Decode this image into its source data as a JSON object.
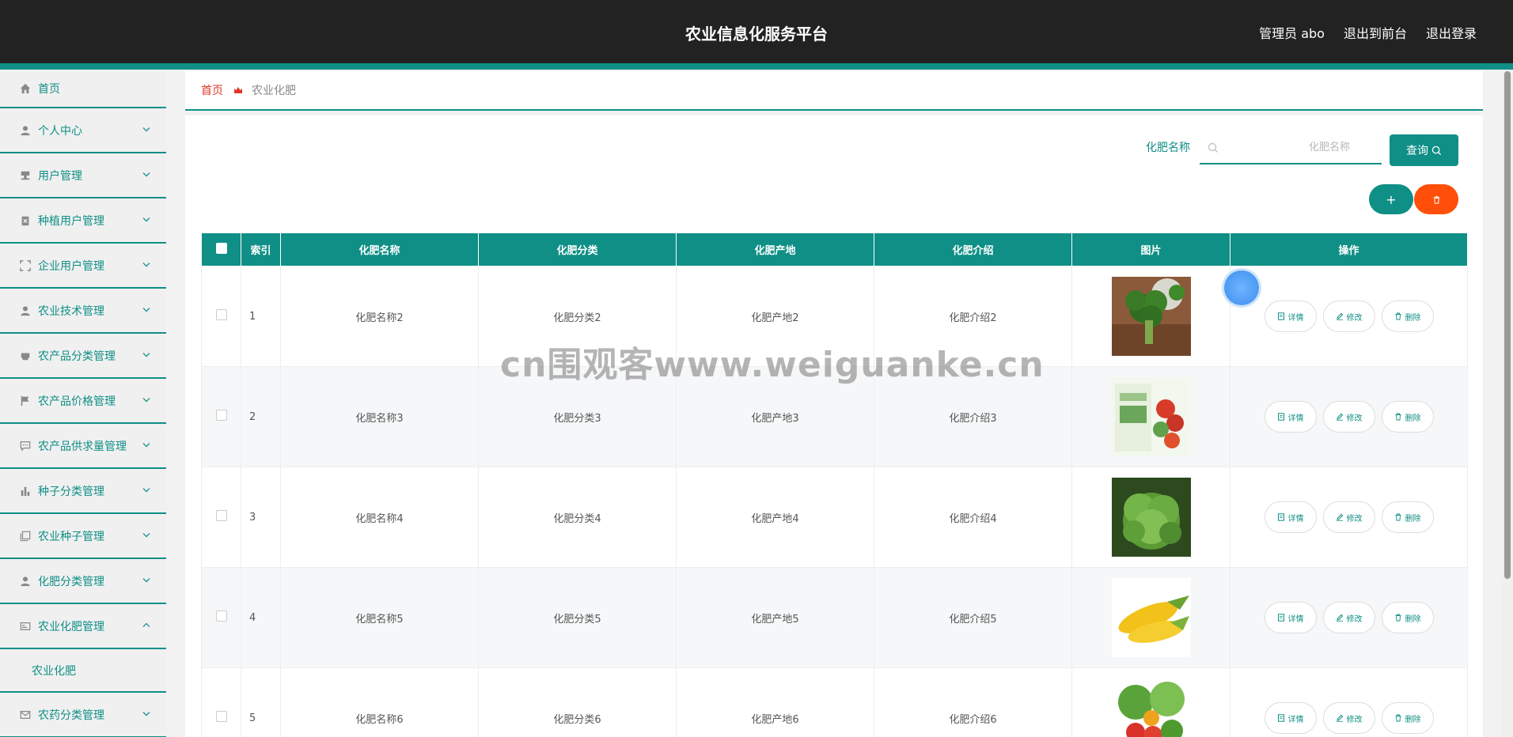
{
  "header": {
    "title": "农业信息化服务平台",
    "user_label": "管理员 abo",
    "to_front_label": "退出到前台",
    "logout_label": "退出登录"
  },
  "sidebar": {
    "items": [
      {
        "label": "首页",
        "icon": "home-icon"
      },
      {
        "label": "个人中心",
        "icon": "user-icon"
      },
      {
        "label": "用户管理",
        "icon": "stamp-icon"
      },
      {
        "label": "种植用户管理",
        "icon": "clipboard-x-icon"
      },
      {
        "label": "企业用户管理",
        "icon": "frame-icon"
      },
      {
        "label": "农业技术管理",
        "icon": "user-icon"
      },
      {
        "label": "农产品分类管理",
        "icon": "printer-icon"
      },
      {
        "label": "农产品价格管理",
        "icon": "flag-icon"
      },
      {
        "label": "农产品供求量管理",
        "icon": "chat-icon"
      },
      {
        "label": "种子分类管理",
        "icon": "bar-chart-icon"
      },
      {
        "label": "农业种子管理",
        "icon": "copy-icon"
      },
      {
        "label": "化肥分类管理",
        "icon": "user-icon"
      },
      {
        "label": "农业化肥管理",
        "icon": "id-card-icon"
      },
      {
        "label": "农药分类管理",
        "icon": "mail-icon"
      }
    ],
    "sub_item": "农业化肥"
  },
  "breadcrumb": {
    "home": "首页",
    "current": "农业化肥"
  },
  "search": {
    "label": "化肥名称",
    "placeholder": "化肥名称",
    "value": "",
    "button": "查询"
  },
  "actions": {
    "add": "+",
    "delete_icon": "trash-icon"
  },
  "table": {
    "columns": [
      "索引",
      "化肥名称",
      "化肥分类",
      "化肥产地",
      "化肥介绍",
      "图片",
      "操作"
    ],
    "rows": [
      {
        "index": "1",
        "name": "化肥名称2",
        "category": "化肥分类2",
        "origin": "化肥产地2",
        "intro": "化肥介绍2",
        "image": "broccoli"
      },
      {
        "index": "2",
        "name": "化肥名称3",
        "category": "化肥分类3",
        "origin": "化肥产地3",
        "intro": "化肥介绍3",
        "image": "produce-box"
      },
      {
        "index": "3",
        "name": "化肥名称4",
        "category": "化肥分类4",
        "origin": "化肥产地4",
        "intro": "化肥介绍4",
        "image": "lettuce"
      },
      {
        "index": "4",
        "name": "化肥名称5",
        "category": "化肥分类5",
        "origin": "化肥产地5",
        "intro": "化肥介绍5",
        "image": "corn"
      },
      {
        "index": "5",
        "name": "化肥名称6",
        "category": "化肥分类6",
        "origin": "化肥产地6",
        "intro": "化肥介绍6",
        "image": "vegetables"
      }
    ],
    "op_labels": {
      "detail": "详情",
      "edit": "修改",
      "delete": "删除"
    }
  },
  "watermark": "cn围观客www.weiguanke.cn",
  "colors": {
    "primary": "#0f8f86",
    "header_bg": "#222222",
    "danger": "#ff4f0a",
    "breadcrumb_home": "#e0372b"
  }
}
